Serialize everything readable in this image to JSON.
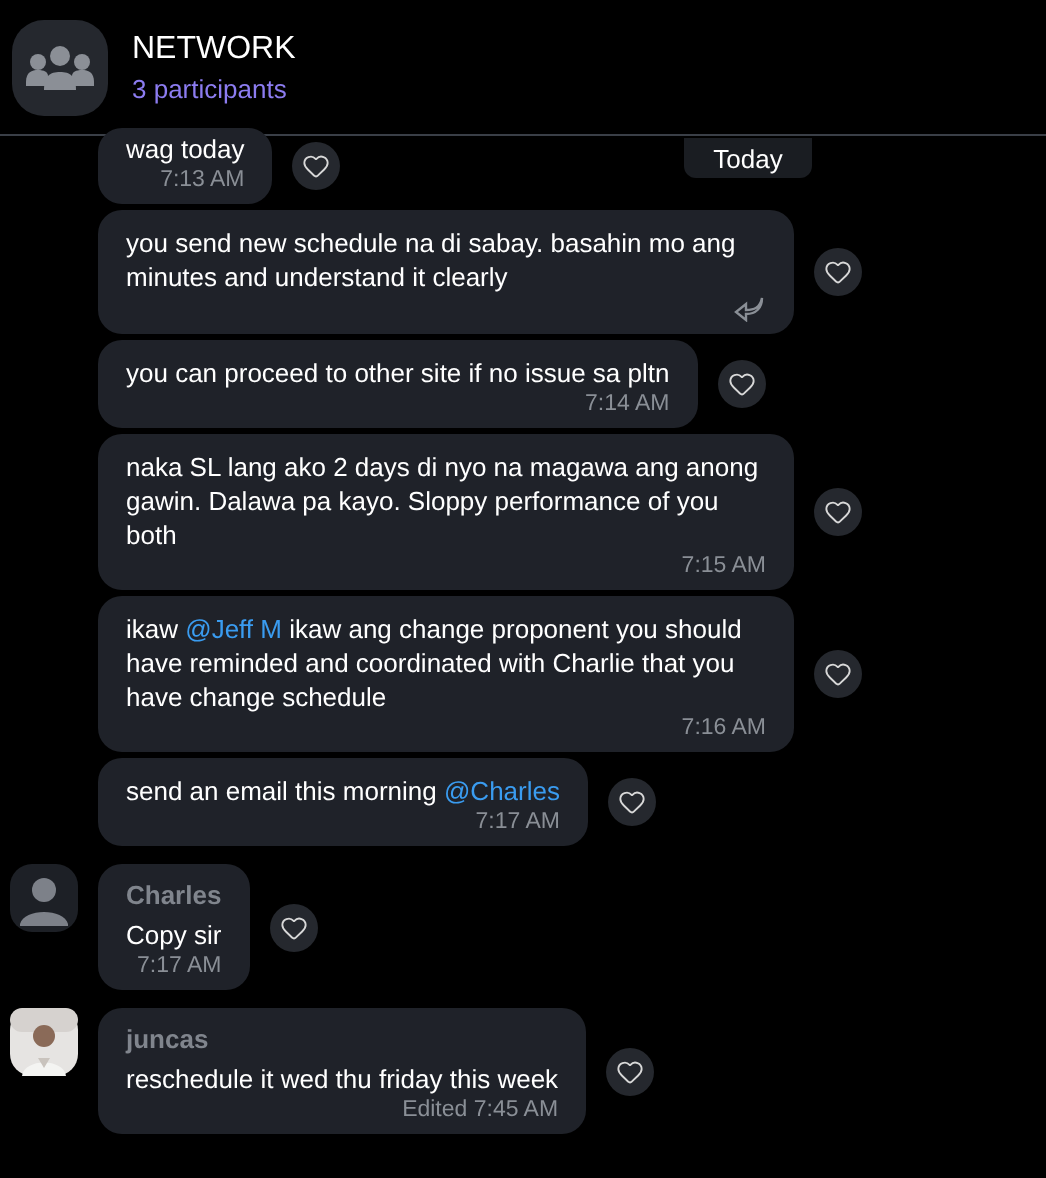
{
  "header": {
    "title": "NETWORK",
    "subtitle": "3 participants"
  },
  "date_chip": "Today",
  "messages": [
    {
      "parts": [
        {
          "kind": "text",
          "text": "wag today"
        }
      ],
      "time": "7:13 AM"
    },
    {
      "parts": [
        {
          "kind": "text",
          "text": "you send new schedule na di sabay. basahin mo ang minutes and understand it clearly"
        }
      ],
      "reply_icon": true
    },
    {
      "parts": [
        {
          "kind": "text",
          "text": "you can proceed to other site if no issue sa pltn"
        }
      ],
      "time": "7:14 AM"
    },
    {
      "parts": [
        {
          "kind": "text",
          "text": "naka SL lang ako 2 days di nyo na magawa ang anong gawin. Dalawa pa kayo. Sloppy performance of you both"
        }
      ],
      "time": "7:15 AM"
    },
    {
      "parts": [
        {
          "kind": "text",
          "text": "ikaw "
        },
        {
          "kind": "mention",
          "text": "@Jeff M"
        },
        {
          "kind": "text",
          "text": " ikaw ang change proponent you should have reminded and coordinated with Charlie that you have change schedule"
        }
      ],
      "time": "7:16 AM"
    },
    {
      "parts": [
        {
          "kind": "text",
          "text": "send an email this morning "
        },
        {
          "kind": "mention",
          "text": "@Charles"
        }
      ],
      "time": "7:17 AM"
    },
    {
      "sender": "Charles",
      "avatar": {
        "kind": "silhouette"
      },
      "parts": [
        {
          "kind": "text",
          "text": "Copy sir"
        }
      ],
      "time": "7:17 AM"
    },
    {
      "sender": "juncas",
      "avatar": {
        "kind": "picture"
      },
      "parts": [
        {
          "kind": "text",
          "text": "reschedule it wed thu friday this week"
        }
      ],
      "time": "Edited 7:45 AM"
    }
  ]
}
